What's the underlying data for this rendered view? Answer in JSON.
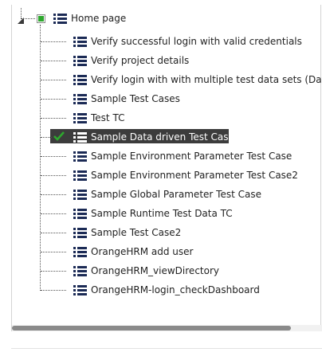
{
  "tree": {
    "root": {
      "label": "Home page"
    },
    "children": [
      {
        "label": "Verify successful login with valid credentials"
      },
      {
        "label": "Verify project details"
      },
      {
        "label": "Verify login with with multiple test data sets (Data"
      },
      {
        "label": "Sample Test Cases"
      },
      {
        "label": "Test TC"
      },
      {
        "label": "Sample Data driven Test Case"
      },
      {
        "label": "Sample Environment Parameter Test Case"
      },
      {
        "label": "Sample Environment Parameter Test Case2"
      },
      {
        "label": "Sample Global Parameter Test Case"
      },
      {
        "label": "Sample Runtime Test Data TC"
      },
      {
        "label": "Sample Test Case2"
      },
      {
        "label": "OrangeHRM add user"
      },
      {
        "label": "OrangeHRM_viewDirectory"
      },
      {
        "label": "OrangeHRM-login_checkDashboard"
      }
    ],
    "selected_index": 5
  },
  "colors": {
    "check_green": "#2ea82e",
    "selected_bg": "#3c3c3c",
    "icon_navy": "#1b2a55",
    "scroll_thumb": "#8a8a8a"
  },
  "icons": {
    "expander": "expanded-triangle-icon",
    "node": "list-icon",
    "checkbox": "green-checkbox-icon",
    "selected_check": "checkmark-icon"
  }
}
